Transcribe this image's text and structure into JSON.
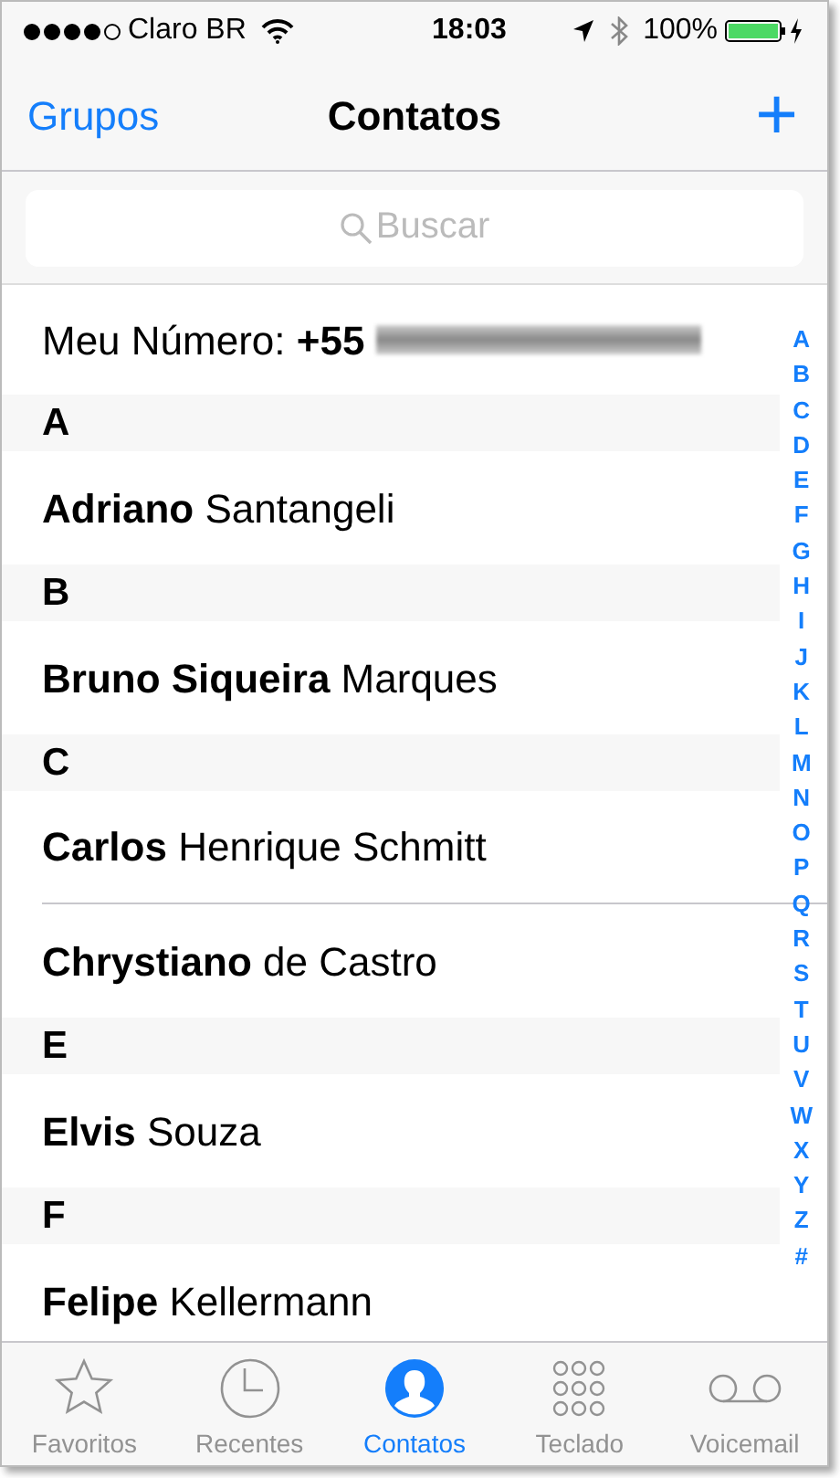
{
  "status_bar": {
    "carrier": "Claro BR",
    "time": "18:03",
    "battery": "100%"
  },
  "nav": {
    "left": "Grupos",
    "title": "Contatos",
    "right": "+"
  },
  "search": {
    "placeholder": "Buscar"
  },
  "my_number": {
    "label": "Meu Número:",
    "prefix": "+55"
  },
  "rows": [
    {
      "kind": "header",
      "text": "A"
    },
    {
      "kind": "contact",
      "bold": "Adriano",
      "rest": "Santangeli"
    },
    {
      "kind": "header",
      "text": "B"
    },
    {
      "kind": "contact",
      "bold": "Bruno Siqueira",
      "rest": "Marques"
    },
    {
      "kind": "header",
      "text": "C"
    },
    {
      "kind": "contact",
      "bold": "Carlos",
      "rest": "Henrique Schmitt"
    },
    {
      "kind": "contact",
      "bold": "Chrystiano",
      "rest": "de Castro"
    },
    {
      "kind": "header",
      "text": "E"
    },
    {
      "kind": "contact",
      "bold": "Elvis",
      "rest": "Souza"
    },
    {
      "kind": "header",
      "text": "F"
    },
    {
      "kind": "contact",
      "bold": "Felipe",
      "rest": "Kellermann"
    }
  ],
  "index": [
    "A",
    "B",
    "C",
    "D",
    "E",
    "F",
    "G",
    "H",
    "I",
    "J",
    "K",
    "L",
    "M",
    "N",
    "O",
    "P",
    "Q",
    "R",
    "S",
    "T",
    "U",
    "V",
    "W",
    "X",
    "Y",
    "Z",
    "#"
  ],
  "tabs": [
    {
      "kind": "star",
      "label": "Favoritos",
      "selected": false
    },
    {
      "kind": "clock",
      "label": "Recentes",
      "selected": false
    },
    {
      "kind": "person",
      "label": "Contatos",
      "selected": true
    },
    {
      "kind": "keypad",
      "label": "Teclado",
      "selected": false
    },
    {
      "kind": "voicemail",
      "label": "Voicemail",
      "selected": false
    }
  ]
}
